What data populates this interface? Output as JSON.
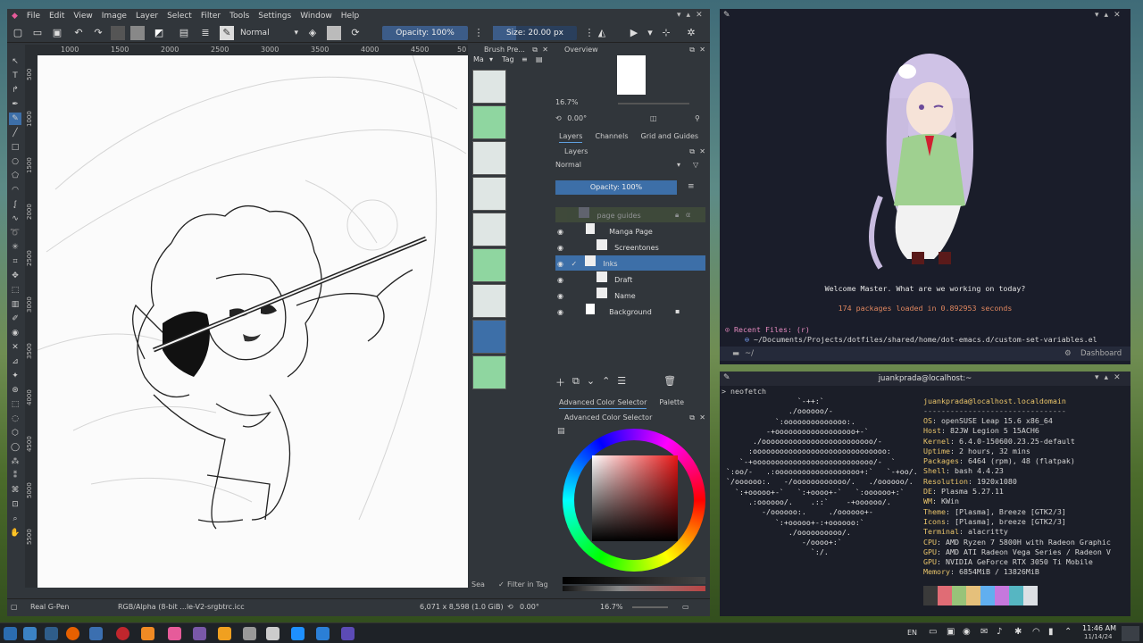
{
  "krita": {
    "menu": [
      "File",
      "Edit",
      "View",
      "Image",
      "Layer",
      "Select",
      "Filter",
      "Tools",
      "Settings",
      "Window",
      "Help"
    ],
    "blend_mode": "Normal",
    "opacity_label": "Opacity: 100%",
    "size_label": "Size: 20.00 px",
    "ruler_marks": [
      "1000",
      "1500",
      "2000",
      "2500",
      "3000",
      "3500",
      "4000",
      "4500",
      "50"
    ],
    "vruler_marks": [
      "500",
      "1000",
      "1500",
      "2000",
      "2500",
      "3000",
      "3500",
      "4000",
      "4500",
      "5000",
      "5500"
    ],
    "brush_panel": {
      "title": "Brush Pre...",
      "filter_value": "Ma",
      "tag_label": "Tag",
      "search_label": "Sea",
      "filter_in_tag": "Filter in Tag"
    },
    "overview": {
      "title": "Overview",
      "zoom": "16.7%",
      "rotation": "0.00°"
    },
    "tabs": [
      "Layers",
      "Channels",
      "Grid and Guides"
    ],
    "layers_panel": {
      "title": "Layers",
      "blend": "Normal",
      "opacity": "Opacity:  100%"
    },
    "layers": [
      {
        "name": "page guides"
      },
      {
        "name": "Manga Page"
      },
      {
        "name": "Screentones"
      },
      {
        "name": "Inks"
      },
      {
        "name": "Draft"
      },
      {
        "name": "Name"
      },
      {
        "name": "Background"
      }
    ],
    "color_tabs": [
      "Advanced Color Selector",
      "Palette"
    ],
    "color_panel_title": "Advanced Color Selector",
    "status": {
      "brush": "Real G-Pen",
      "color_space": "RGB/Alpha (8-bit ...le-V2-srgbtrc.icc",
      "dimensions": "6,071 x 8,598 (1.0 GiB)",
      "rotation": "0.00°",
      "zoom": "16.7%"
    }
  },
  "emacs": {
    "welcome": "Welcome Master. What are we working on today?",
    "packages": "174 packages loaded in 0.892953 seconds",
    "recent_label": "Recent Files: (r)",
    "recent_file": "~/Documents/Projects/dotfiles/shared/home/dot-emacs.d/custom-set-variables.el",
    "modeline_path": "~/",
    "modeline_right": "Dashboard"
  },
  "konsole": {
    "title": "juankprada@localhost:~",
    "command": "neofetch",
    "ascii": [
      "                 `-++:`",
      "               ./oooooo/-",
      "            `:oooooooooooooo:.",
      "          -+oooooooooooooooooo+-`",
      "       ./ooooooooooooooooooooooooo/-",
      "      :oooooooooooooooooooooooooooooo:",
      "    `-+ooooooooooooooooooooooooooo/-  `",
      " `:oo/-   .:ooooooooooooooooooo+:`   `-+oo/.",
      " `/oooooo:.   -/oooooooooooo/.   ./oooooo/.",
      "   `:+ooooo+-`   `:+oooo+-`   `:oooooo+:`",
      "      .:oooooo/.    .::`    -+oooooo/.",
      "         -/oooooo:.     ./oooooo+-",
      "            `:+ooooo+-:+oooooo:`",
      "               ./oooooooooo/.",
      "                  -/oooo+:`",
      "                    `:/."
    ],
    "user_host": "juankprada@localhost.localdomain",
    "separator": "--------------------------------",
    "info": [
      {
        "k": "OS",
        "v": "openSUSE Leap 15.6 x86_64"
      },
      {
        "k": "Host",
        "v": "82JW Legion 5 15ACH6"
      },
      {
        "k": "Kernel",
        "v": "6.4.0-150600.23.25-default"
      },
      {
        "k": "Uptime",
        "v": "2 hours, 32 mins"
      },
      {
        "k": "Packages",
        "v": "6464 (rpm), 48 (flatpak)"
      },
      {
        "k": "Shell",
        "v": "bash 4.4.23"
      },
      {
        "k": "Resolution",
        "v": "1920x1080"
      },
      {
        "k": "DE",
        "v": "Plasma 5.27.11"
      },
      {
        "k": "WM",
        "v": "KWin"
      },
      {
        "k": "Theme",
        "v": "[Plasma], Breeze [GTK2/3]"
      },
      {
        "k": "Icons",
        "v": "[Plasma], breeze [GTK2/3]"
      },
      {
        "k": "Terminal",
        "v": "alacritty"
      },
      {
        "k": "CPU",
        "v": "AMD Ryzen 7 5800H with Radeon Graphic"
      },
      {
        "k": "GPU",
        "v": "AMD ATI Radeon Vega Series / Radeon V"
      },
      {
        "k": "GPU",
        "v": "NVIDIA GeForce RTX 3050 Ti Mobile"
      },
      {
        "k": "Memory",
        "v": "6854MiB / 13826MiB"
      }
    ],
    "palette": [
      "#3a3a3a",
      "#e06c75",
      "#98c379",
      "#e5c07b",
      "#61afef",
      "#c678dd",
      "#56b6c2",
      "#dcdfe4"
    ]
  },
  "taskbar": {
    "lang": "EN",
    "time": "11:46 AM",
    "date": "11/14/24"
  }
}
